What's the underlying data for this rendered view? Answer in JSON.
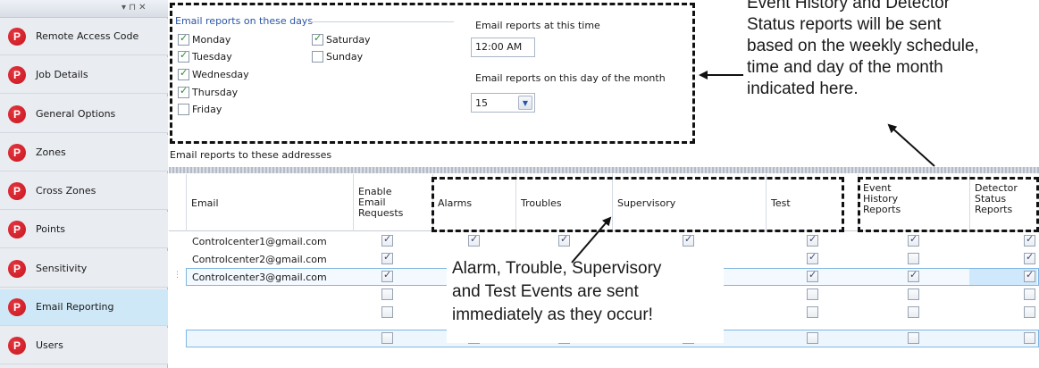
{
  "sidebar": {
    "pin_glyph": "▾ ⊓ ✕",
    "items": [
      {
        "label": "Remote Access Code",
        "icon": "p-logo-icon"
      },
      {
        "label": "Job Details",
        "icon": "p-logo-icon"
      },
      {
        "label": "General Options",
        "icon": "p-logo-icon"
      },
      {
        "label": "Zones",
        "icon": "p-logo-icon"
      },
      {
        "label": "Cross Zones",
        "icon": "p-logo-icon"
      },
      {
        "label": "Points",
        "icon": "p-logo-icon"
      },
      {
        "label": "Sensitivity",
        "icon": "p-logo-icon"
      },
      {
        "label": "Email Reporting",
        "icon": "p-logo-icon",
        "active": true
      },
      {
        "label": "Users",
        "icon": "p-logo-icon"
      }
    ],
    "icon_glyph": "P",
    "icon_color": "#c8161f"
  },
  "days": {
    "title": "Email reports on these days",
    "monday": "Monday",
    "tuesday": "Tuesday",
    "wednesday": "Wednesday",
    "thursday": "Thursday",
    "friday": "Friday",
    "saturday": "Saturday",
    "sunday": "Sunday",
    "checked": {
      "monday": true,
      "tuesday": true,
      "wednesday": true,
      "thursday": true,
      "friday": false,
      "saturday": true,
      "sunday": false
    }
  },
  "time": {
    "label": "Email reports at this time",
    "value": "12:00 AM"
  },
  "day_of_month": {
    "label": "Email reports on this day of the month",
    "value": "15"
  },
  "addresses": {
    "section_label": "Email reports to these addresses",
    "columns": {
      "email": "Email",
      "enable": "Enable\nEmail\nRequests",
      "alarms": "Alarms",
      "troubles": "Troubles",
      "supervisory": "Supervisory",
      "test": "Test",
      "event_history": "Event\nHistory\nReports",
      "detector_status": "Detector\nStatus\nReports"
    },
    "rows": [
      {
        "email": "Controlcenter1@gmail.com",
        "enable": true,
        "alarms": true,
        "troubles": true,
        "supervisory": true,
        "test": true,
        "event_history": true,
        "detector_status": true
      },
      {
        "email": "Controlcenter2@gmail.com",
        "enable": true,
        "alarms": null,
        "troubles": null,
        "supervisory": null,
        "test": true,
        "event_history": false,
        "detector_status": true
      },
      {
        "email": "Controlcenter3@gmail.com",
        "enable": true,
        "alarms": null,
        "troubles": null,
        "supervisory": null,
        "test": true,
        "event_history": true,
        "detector_status": true
      },
      {
        "email": "",
        "enable": false,
        "alarms": null,
        "troubles": null,
        "supervisory": null,
        "test": false,
        "event_history": false,
        "detector_status": false
      },
      {
        "email": "",
        "enable": false,
        "alarms": null,
        "troubles": null,
        "supervisory": null,
        "test": false,
        "event_history": false,
        "detector_status": false
      },
      {
        "email": "",
        "enable": false,
        "alarms": false,
        "troubles": false,
        "supervisory": false,
        "test": false,
        "event_history": false,
        "detector_status": false
      }
    ]
  },
  "annotations": {
    "event_history": [
      "Event History and Detector",
      "Status reports will be sent",
      "based on the weekly schedule,",
      "time and day of the month",
      "indicated here."
    ],
    "alarm": [
      "Alarm, Trouble, Supervisory",
      "and Test Events are sent",
      "immediately as they occur!"
    ]
  },
  "colors": {
    "accent": "#2a55a5",
    "selection": "#cfe8f7"
  }
}
